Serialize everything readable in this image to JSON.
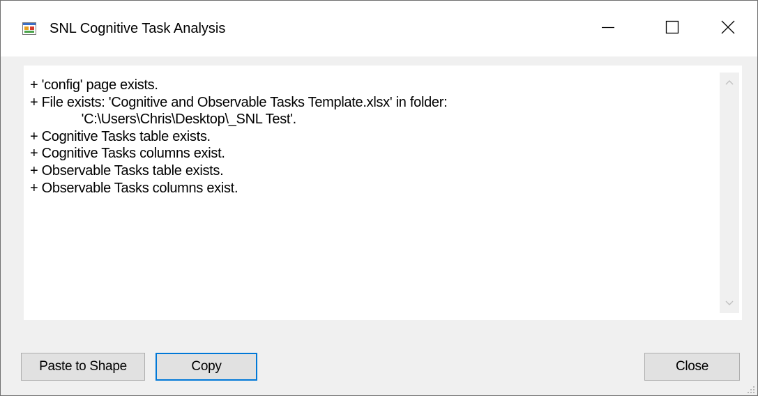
{
  "window": {
    "title": "SNL Cognitive Task Analysis",
    "icon": "app-form-icon",
    "controls": [
      "minimize-icon",
      "maximize-icon",
      "close-icon"
    ]
  },
  "log": {
    "lines": [
      "+ 'config' page exists.",
      "+ File exists: 'Cognitive and Observable Tasks Template.xlsx' in folder:",
      "              'C:\\Users\\Chris\\Desktop\\_SNL Test'.",
      "+ Cognitive Tasks table exists.",
      "+ Cognitive Tasks columns exist.",
      "+ Observable Tasks table exists.",
      "+ Observable Tasks columns exist."
    ]
  },
  "buttons": {
    "paste_label": "Paste to Shape",
    "copy_label": "Copy",
    "close_label": "Close"
  },
  "colors": {
    "focus_border": "#0078d7",
    "button_face": "#e1e1e1",
    "window_bg": "#f0f0f0"
  }
}
